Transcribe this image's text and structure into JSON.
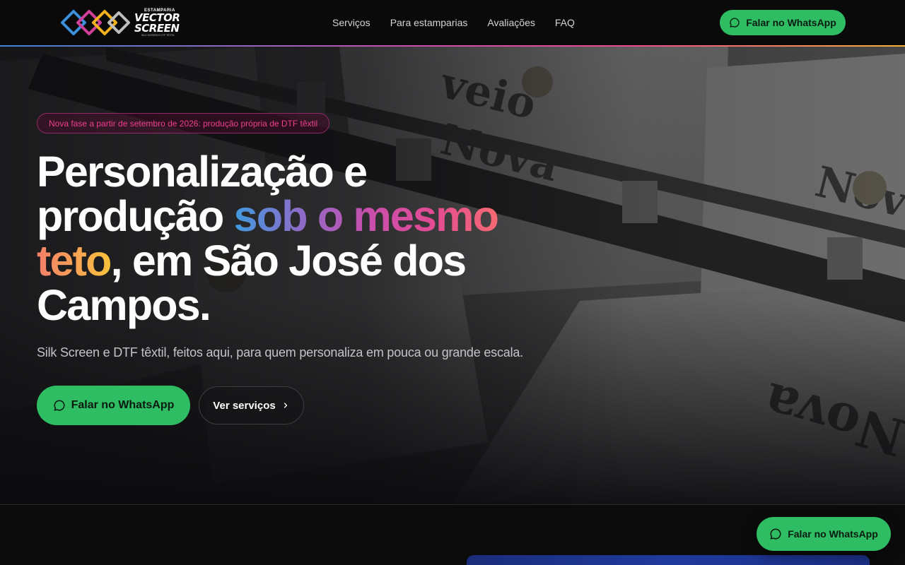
{
  "brand": {
    "small": "ESTAMPARIA",
    "name_line1": "VECTOR",
    "name_line2": "SCREEN",
    "tagline": "SILK SCREEN E DTF TÊXTIL"
  },
  "nav": {
    "items": [
      {
        "label": "Serviços"
      },
      {
        "label": "Para estamparias"
      },
      {
        "label": "Avaliações"
      },
      {
        "label": "FAQ"
      }
    ]
  },
  "header": {
    "cta_label": "Falar no WhatsApp"
  },
  "hero": {
    "badge": "Nova fase a partir de setembro de 2026: produção própria de DTF têxtil",
    "headline": {
      "part1": "Personalização e produção ",
      "highlight1": "sob o mesmo",
      "space": " ",
      "highlight2": "teto",
      "part2": ", em São José dos Campos."
    },
    "subtitle": "Silk Screen e DTF têxtil, feitos aqui, para quem personaliza em pouca ou grande escala.",
    "primary_cta": "Falar no WhatsApp",
    "secondary_cta": "Ver serviços"
  },
  "floating": {
    "cta_label": "Falar no WhatsApp"
  },
  "colors": {
    "whatsapp_green": "#2ebd63",
    "badge_pink": "#ee3f8f",
    "gradient_blue": "#3f9ae0",
    "gradient_pink": "#e34b94",
    "gradient_orange": "#f8a851"
  },
  "icons": {
    "whatsapp": "whatsapp-icon",
    "chevron": "chevron-right-icon"
  }
}
